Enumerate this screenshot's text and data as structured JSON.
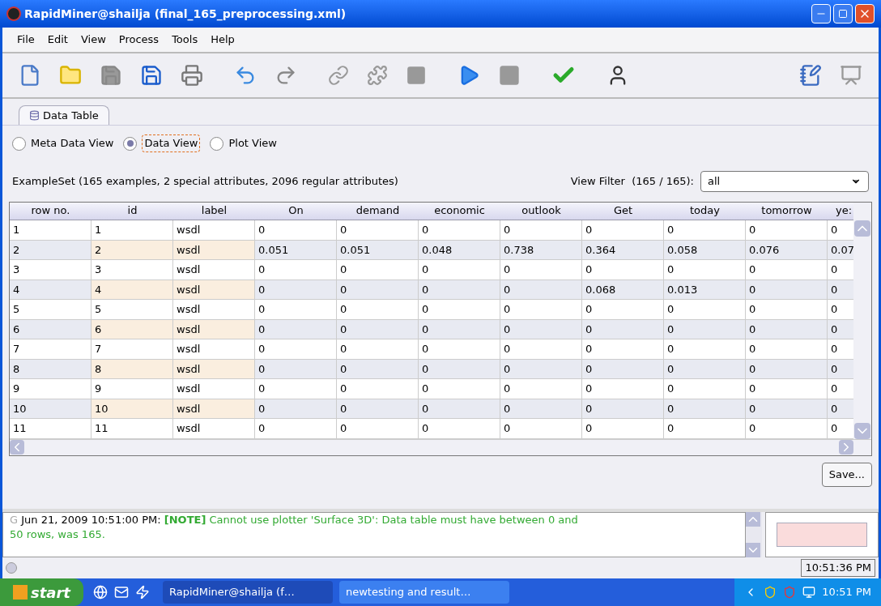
{
  "window": {
    "title": "RapidMiner@shailja (final_165_preprocessing.xml)"
  },
  "menu": [
    "File",
    "Edit",
    "View",
    "Process",
    "Tools",
    "Help"
  ],
  "tabs": [
    {
      "label": "Data Table",
      "selected": true
    }
  ],
  "views": [
    {
      "label": "Meta Data View",
      "selected": false
    },
    {
      "label": "Data View",
      "selected": true
    },
    {
      "label": "Plot View",
      "selected": false
    }
  ],
  "summary": "ExampleSet (165 examples, 2 special attributes, 2096 regular attributes)",
  "view_filter": {
    "label": "View Filter  (165 / 165):",
    "value": "all"
  },
  "table": {
    "columns": [
      "row no.",
      "id",
      "label",
      "On",
      "demand",
      "economic",
      "outlook",
      "Get",
      "today",
      "tomorrow",
      "ye:"
    ],
    "rows": [
      [
        "1",
        "1",
        "wsdl",
        "0",
        "0",
        "0",
        "0",
        "0",
        "0",
        "0",
        "0"
      ],
      [
        "2",
        "2",
        "wsdl",
        "0.051",
        "0.051",
        "0.048",
        "0.738",
        "0.364",
        "0.058",
        "0.076",
        "0.07"
      ],
      [
        "3",
        "3",
        "wsdl",
        "0",
        "0",
        "0",
        "0",
        "0",
        "0",
        "0",
        "0"
      ],
      [
        "4",
        "4",
        "wsdl",
        "0",
        "0",
        "0",
        "0",
        "0.068",
        "0.013",
        "0",
        "0"
      ],
      [
        "5",
        "5",
        "wsdl",
        "0",
        "0",
        "0",
        "0",
        "0",
        "0",
        "0",
        "0"
      ],
      [
        "6",
        "6",
        "wsdl",
        "0",
        "0",
        "0",
        "0",
        "0",
        "0",
        "0",
        "0"
      ],
      [
        "7",
        "7",
        "wsdl",
        "0",
        "0",
        "0",
        "0",
        "0",
        "0",
        "0",
        "0"
      ],
      [
        "8",
        "8",
        "wsdl",
        "0",
        "0",
        "0",
        "0",
        "0",
        "0",
        "0",
        "0"
      ],
      [
        "9",
        "9",
        "wsdl",
        "0",
        "0",
        "0",
        "0",
        "0",
        "0",
        "0",
        "0"
      ],
      [
        "10",
        "10",
        "wsdl",
        "0",
        "0",
        "0",
        "0",
        "0",
        "0",
        "0",
        "0"
      ],
      [
        "11",
        "11",
        "wsdl",
        "0",
        "0",
        "0",
        "0",
        "0",
        "0",
        "0",
        "0"
      ]
    ]
  },
  "save_button": "Save...",
  "log": {
    "prefix": "G",
    "time": "Jun 21, 2009 10:51:00 PM:",
    "tag": "[NOTE]",
    "message": "Cannot use plotter 'Surface 3D': Data table must have between 0 and 50 rows, was 165."
  },
  "status_bar": {
    "time": "10:51:36 PM"
  },
  "taskbar": {
    "start": "start",
    "tasks": [
      {
        "label": "RapidMiner@shailja (f…",
        "selected": true
      },
      {
        "label": "newtesting and result…",
        "selected": false
      }
    ],
    "clock": "10:51 PM"
  }
}
